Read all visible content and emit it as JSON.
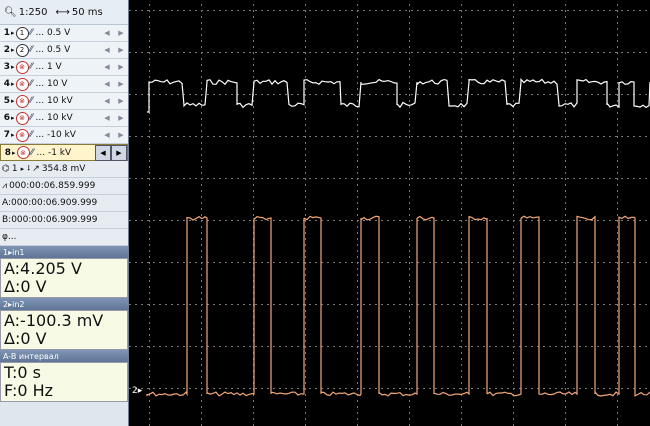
{
  "toolbar": {
    "zoom": "1:250",
    "timebase": "50 ms"
  },
  "channels": [
    {
      "num": "1",
      "icon": "1",
      "value": "... 0.5 V",
      "enabled": true
    },
    {
      "num": "2",
      "icon": "2",
      "value": "... 0.5 V",
      "enabled": true
    },
    {
      "num": "3",
      "icon": "x",
      "value": "... 1 V",
      "enabled": false
    },
    {
      "num": "4",
      "icon": "x",
      "value": "... 10 V",
      "enabled": false
    },
    {
      "num": "5",
      "icon": "x",
      "value": "... 10 kV",
      "enabled": false
    },
    {
      "num": "6",
      "icon": "x",
      "value": "... 10 kV",
      "enabled": false
    },
    {
      "num": "7",
      "icon": "x",
      "value": "... -10 kV",
      "enabled": false
    },
    {
      "num": "8",
      "icon": "x",
      "value": "... -1 kV",
      "enabled": false,
      "selected": true
    }
  ],
  "trigger": {
    "channel": "1",
    "level": "354.8 mV"
  },
  "trigger_time": "000:00:06.859.999",
  "cursor_a": "A:000:00:06.909.999",
  "cursor_b": "B:000:00:06.909.999",
  "phi": "φ...",
  "measure_ch1": {
    "header": "1▸in1",
    "a": "A:4.205 V",
    "delta": "Δ:0 V"
  },
  "measure_ch2": {
    "header": "2▸in2",
    "a": "A:-100.3 mV",
    "delta": "Δ:0 V"
  },
  "interval": {
    "header": "A-B интервал",
    "t": "T:0 s",
    "f": "F:0 Hz"
  },
  "scope": {
    "ch2_marker": "2"
  },
  "colors": {
    "ch1": "#ffffff",
    "ch2": "#f2a878",
    "grid": "#7a7a7a",
    "background": "#000000"
  }
}
